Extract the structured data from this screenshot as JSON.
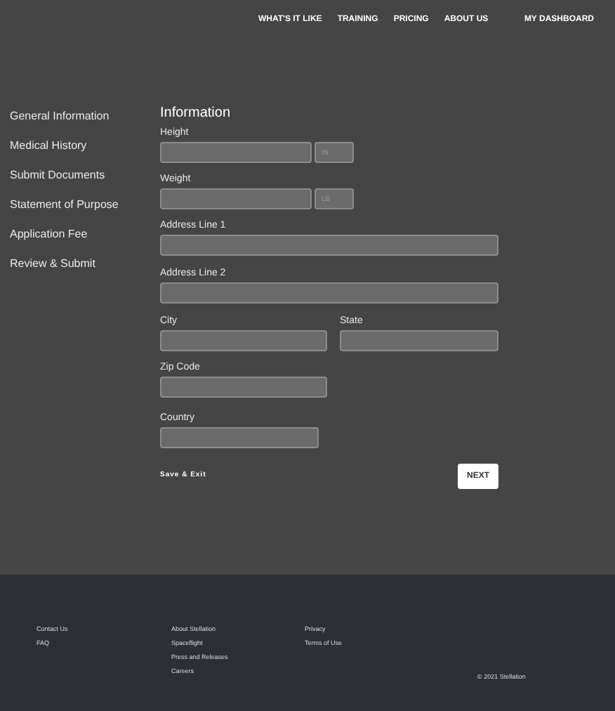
{
  "nav": {
    "links": [
      "WHAT'S IT LIKE",
      "TRAINING",
      "PRICING",
      "ABOUT US"
    ],
    "dashboard": "MY DASHBOARD"
  },
  "sidebar": {
    "items": [
      "General Information",
      "Medical History",
      "Submit Documents",
      "Statement of Purpose",
      "Application Fee",
      "Review & Submit"
    ]
  },
  "form": {
    "title": "Information",
    "rows": [
      {
        "kind": "measure",
        "label": "Height",
        "placeholder": "IN"
      },
      {
        "kind": "measure",
        "label": "Weight",
        "placeholder": "LB"
      },
      {
        "kind": "full",
        "label": "Address Line 1"
      },
      {
        "kind": "full",
        "label": "Address Line 2"
      },
      {
        "kind": "pair",
        "fields": [
          {
            "label": "City"
          },
          {
            "label": "State"
          }
        ]
      },
      {
        "kind": "half",
        "label": "Zip Code"
      },
      {
        "kind": "short",
        "label": "Country"
      }
    ],
    "save": "Save & Exit",
    "next": "NEXT"
  },
  "footer": {
    "columns": [
      [
        "Contact Us",
        "FAQ"
      ],
      [
        "About Stellation",
        "Spaceflight",
        "Press and Releases",
        "Careers"
      ],
      [
        "Privacy",
        "Terms of Use"
      ]
    ],
    "copyright": "© 2021 Stellation"
  }
}
